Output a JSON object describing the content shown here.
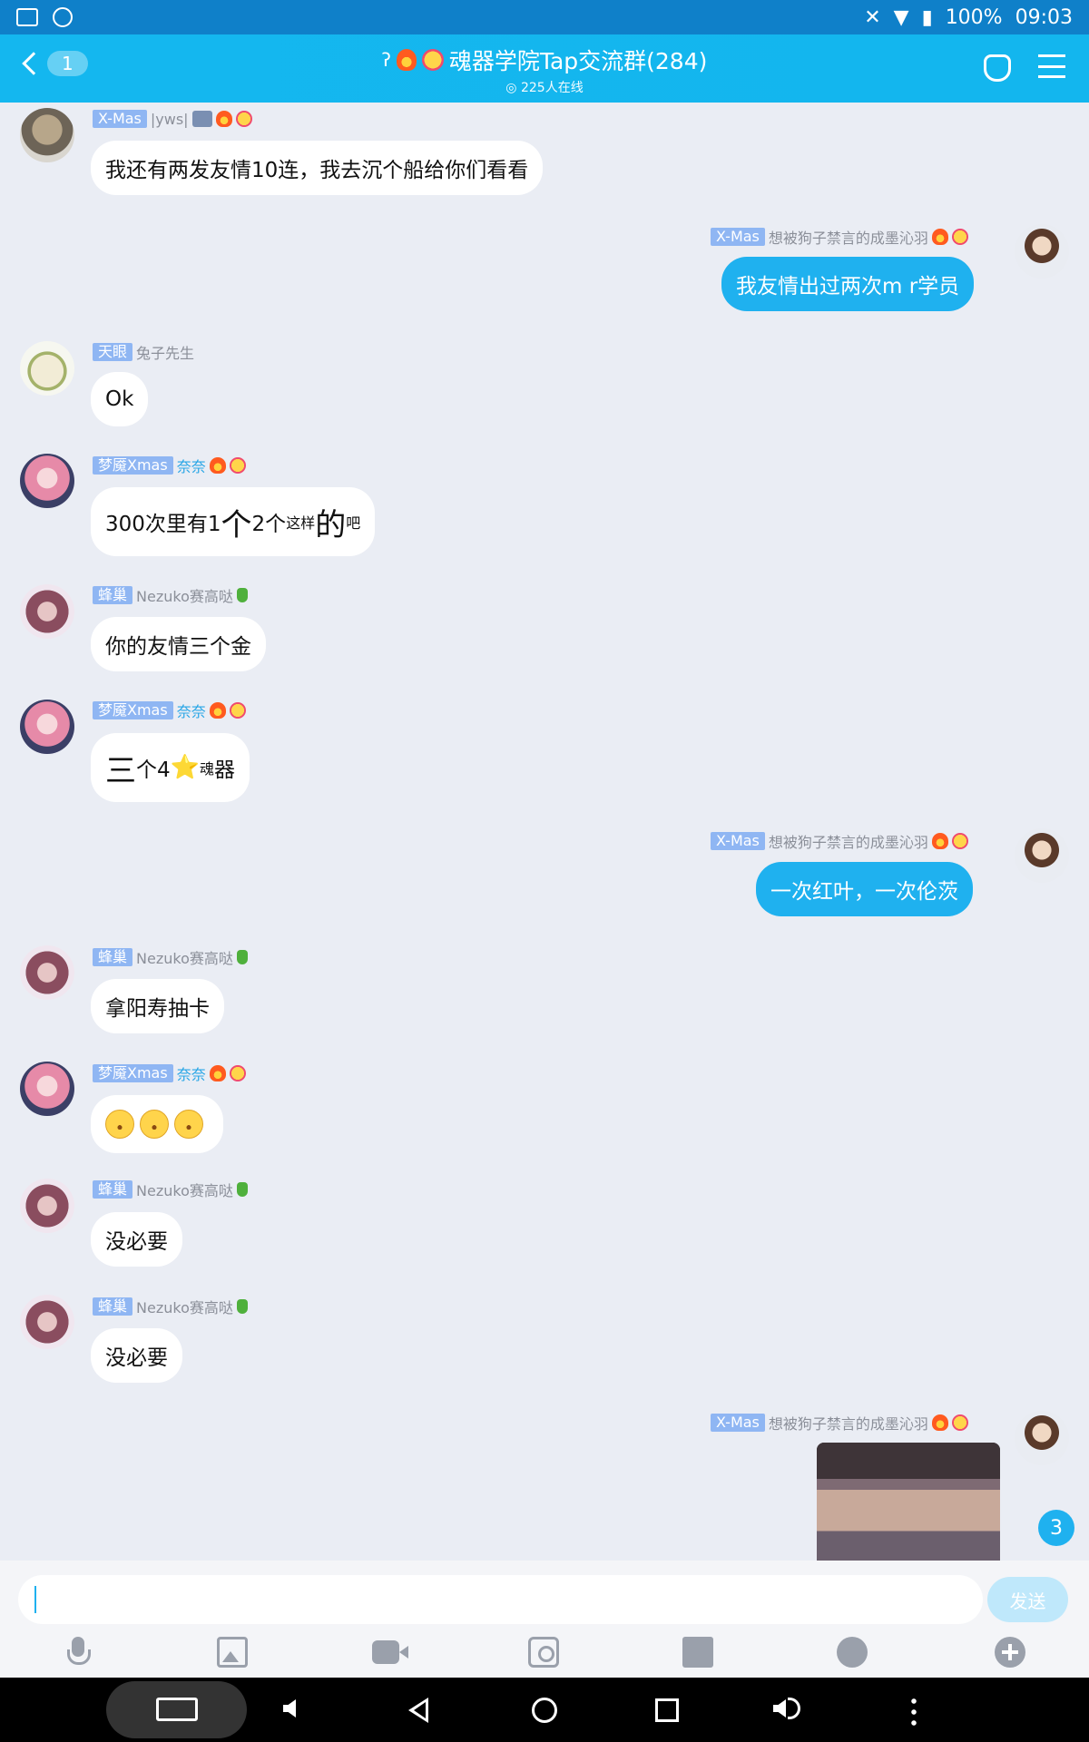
{
  "status_bar": {
    "battery": "100%",
    "time": "09:03"
  },
  "header": {
    "unread_count": "1",
    "title": "魂器学院Tap交流群(284)",
    "online": "225人在线"
  },
  "messages": [
    {
      "tag": "X-Mas",
      "name": "|yws|",
      "text": "我还有两发友情10连，我去沉个船给你们看看"
    },
    {
      "tag": "X-Mas",
      "name": "想被狗子禁言的成墨沁羽",
      "text": "我友情出过两次m r学员"
    },
    {
      "tag": "天眼",
      "name": "兔子先生",
      "text": "Ok"
    },
    {
      "tag": "梦魇Xmas",
      "name": "奈奈",
      "parts": [
        "300次里有1",
        "个",
        "2个",
        "这样",
        "的",
        "吧"
      ]
    },
    {
      "tag": "蜂巢",
      "name": "Nezuko赛高哒",
      "text": "你的友情三个金"
    },
    {
      "tag": "梦魇Xmas",
      "name": "奈奈",
      "parts": [
        "三",
        "个4",
        "⭐",
        "魂",
        "器"
      ]
    },
    {
      "tag": "X-Mas",
      "name": "想被狗子禁言的成墨沁羽",
      "text": "一次红叶，一次伦茨"
    },
    {
      "tag": "蜂巢",
      "name": "Nezuko赛高哒",
      "text": "拿阳寿抽卡"
    },
    {
      "tag": "梦魇Xmas",
      "name": "奈奈",
      "text": ""
    },
    {
      "tag": "蜂巢",
      "name": "Nezuko赛高哒",
      "text": "没必要"
    },
    {
      "tag": "蜂巢",
      "name": "Nezuko赛高哒",
      "text": "没必要"
    },
    {
      "tag": "X-Mas",
      "name": "想被狗子禁言的成墨沁羽",
      "text": ""
    }
  ],
  "new_message_count": "3",
  "input": {
    "value": "",
    "send_label": "发送"
  },
  "tools": [
    "mic-icon",
    "image-icon",
    "video-icon",
    "camera-icon",
    "gift-icon",
    "smile-icon",
    "plus-icon"
  ]
}
